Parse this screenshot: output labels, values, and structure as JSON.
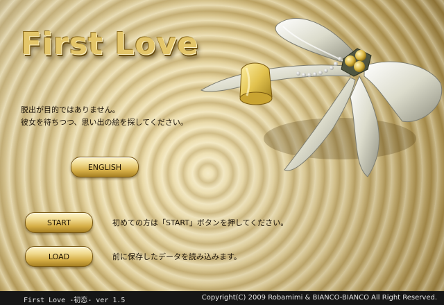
{
  "title": "First Love",
  "intro": {
    "line1": "脱出が目的ではありません。",
    "line2": "彼女を待ちつつ、思い出の絵を探してください。"
  },
  "buttons": {
    "english": "ENGLISH",
    "start": "START",
    "load": "LOAD"
  },
  "descriptions": {
    "start": "初めての方は「START」ボタンを押してください。",
    "load": "前に保存したデータを読み込みます。"
  },
  "footer": {
    "left": "First Love -初恋- ver 1.5",
    "right": "Copyright(C) 2009 Robamimi & BIANCO-BIANCO All Right Reserved."
  }
}
